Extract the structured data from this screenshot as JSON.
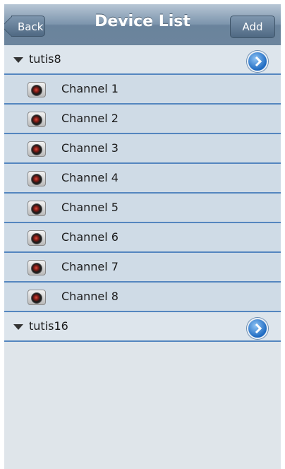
{
  "nav": {
    "title": "Device List",
    "back_label": "Back",
    "add_label": "Add"
  },
  "groups": [
    {
      "name": "tutis8",
      "channels": [
        "Channel 1",
        "Channel 2",
        "Channel 3",
        "Channel 4",
        "Channel 5",
        "Channel 6",
        "Channel 7",
        "Channel 8"
      ]
    },
    {
      "name": "tutis16",
      "channels": []
    }
  ],
  "icons": {
    "expand": "triangle-down-icon",
    "detail": "chevron-right-icon",
    "channel": "camera-icon"
  },
  "colors": {
    "navbar": "#7d95ad",
    "separator": "#5486bf",
    "background": "#dfe5ea"
  }
}
